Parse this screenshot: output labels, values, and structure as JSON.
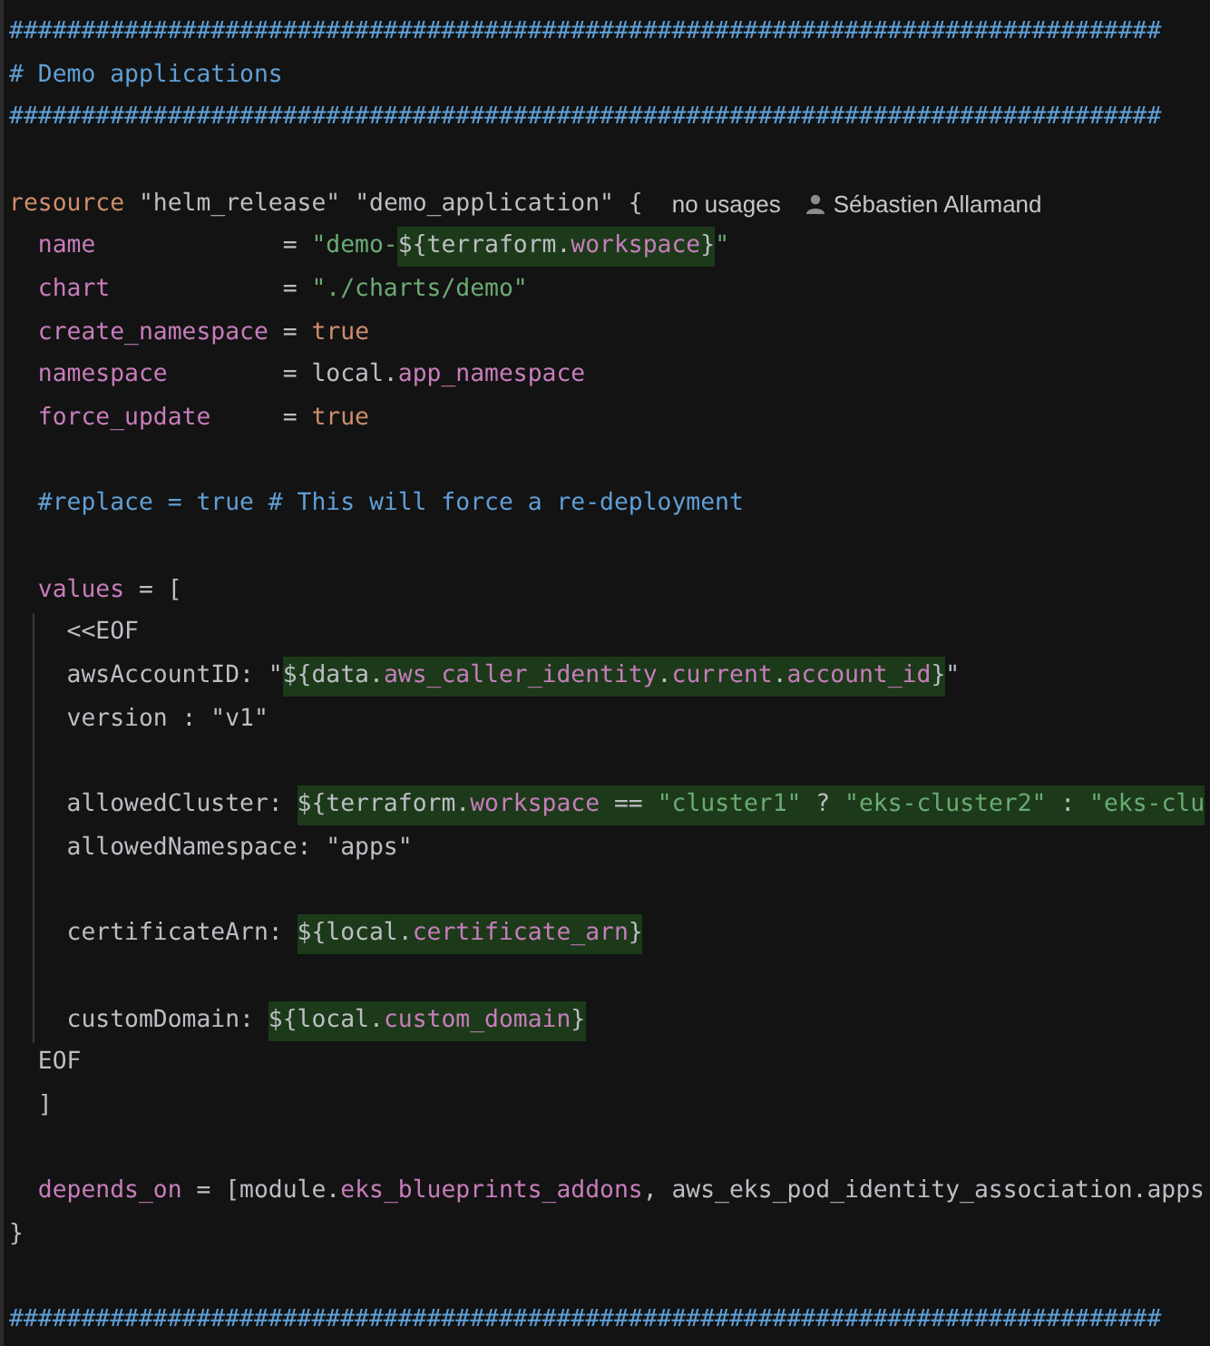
{
  "editor": {
    "lines": [
      {
        "kind": "code",
        "guide": false,
        "tokens": [
          {
            "kind": "comment",
            "text": "################################################################################"
          }
        ]
      },
      {
        "kind": "code",
        "guide": false,
        "tokens": [
          {
            "kind": "comment",
            "text": "# Demo applications"
          }
        ]
      },
      {
        "kind": "code",
        "guide": false,
        "tokens": [
          {
            "kind": "comment",
            "text": "################################################################################"
          }
        ]
      },
      {
        "kind": "blank",
        "guide": false
      },
      {
        "kind": "code",
        "guide": false,
        "tokens": [
          {
            "kind": "keyword",
            "text": "resource"
          },
          {
            "kind": "plain",
            "text": " \"helm_release\" \"demo_application\" {"
          }
        ],
        "hints": [
          {
            "kind": "usages",
            "text": "no usages"
          },
          {
            "kind": "author",
            "text": "Sébastien Allamand"
          }
        ]
      },
      {
        "kind": "code",
        "guide": false,
        "tokens": [
          {
            "kind": "property",
            "text": "  name"
          },
          {
            "kind": "plain",
            "text": "             = "
          },
          {
            "kind": "string",
            "text": "\"demo-"
          },
          {
            "kind": "interpolation",
            "tokens": [
              {
                "kind": "plain",
                "text": "${terraform."
              },
              {
                "kind": "member",
                "text": "workspace"
              },
              {
                "kind": "plain",
                "text": "}"
              }
            ]
          },
          {
            "kind": "string",
            "text": "\""
          }
        ]
      },
      {
        "kind": "code",
        "guide": false,
        "tokens": [
          {
            "kind": "property",
            "text": "  chart"
          },
          {
            "kind": "plain",
            "text": "            = "
          },
          {
            "kind": "string",
            "text": "\"./charts/demo\""
          }
        ]
      },
      {
        "kind": "code",
        "guide": false,
        "tokens": [
          {
            "kind": "property",
            "text": "  create_namespace"
          },
          {
            "kind": "plain",
            "text": " = "
          },
          {
            "kind": "bool",
            "text": "true"
          }
        ]
      },
      {
        "kind": "code",
        "guide": false,
        "tokens": [
          {
            "kind": "property",
            "text": "  namespace"
          },
          {
            "kind": "plain",
            "text": "        = local."
          },
          {
            "kind": "member",
            "text": "app_namespace"
          }
        ]
      },
      {
        "kind": "code",
        "guide": false,
        "tokens": [
          {
            "kind": "property",
            "text": "  force_update"
          },
          {
            "kind": "plain",
            "text": "     = "
          },
          {
            "kind": "bool",
            "text": "true"
          }
        ]
      },
      {
        "kind": "blank",
        "guide": false
      },
      {
        "kind": "code",
        "guide": false,
        "tokens": [
          {
            "kind": "comment",
            "text": "  #replace = true # This will force a re-deployment"
          }
        ]
      },
      {
        "kind": "blank",
        "guide": false
      },
      {
        "kind": "code",
        "guide": false,
        "tokens": [
          {
            "kind": "property",
            "text": "  values"
          },
          {
            "kind": "plain",
            "text": " = ["
          }
        ]
      },
      {
        "kind": "code",
        "guide": true,
        "tokens": [
          {
            "kind": "plain",
            "text": "    <<EOF"
          }
        ]
      },
      {
        "kind": "code",
        "guide": true,
        "tokens": [
          {
            "kind": "plain",
            "text": "    awsAccountID: \""
          },
          {
            "kind": "interpolation",
            "tokens": [
              {
                "kind": "plain",
                "text": "${data."
              },
              {
                "kind": "member",
                "text": "aws_caller_identity"
              },
              {
                "kind": "plain",
                "text": "."
              },
              {
                "kind": "member",
                "text": "current"
              },
              {
                "kind": "plain",
                "text": "."
              },
              {
                "kind": "member",
                "text": "account_id"
              },
              {
                "kind": "plain",
                "text": "}"
              }
            ]
          },
          {
            "kind": "plain",
            "text": "\""
          }
        ]
      },
      {
        "kind": "code",
        "guide": true,
        "tokens": [
          {
            "kind": "plain",
            "text": "    version : \"v1\""
          }
        ]
      },
      {
        "kind": "blank",
        "guide": true
      },
      {
        "kind": "code",
        "guide": true,
        "tokens": [
          {
            "kind": "plain",
            "text": "    allowedCluster: "
          },
          {
            "kind": "interpolation",
            "tokens": [
              {
                "kind": "plain",
                "text": "${terraform."
              },
              {
                "kind": "member",
                "text": "workspace"
              },
              {
                "kind": "plain",
                "text": " == "
              },
              {
                "kind": "string",
                "text": "\"cluster1\""
              },
              {
                "kind": "plain",
                "text": " ? "
              },
              {
                "kind": "string",
                "text": "\"eks-cluster2\""
              },
              {
                "kind": "plain",
                "text": " : "
              },
              {
                "kind": "string",
                "text": "\"eks-clu"
              }
            ]
          }
        ]
      },
      {
        "kind": "code",
        "guide": true,
        "tokens": [
          {
            "kind": "plain",
            "text": "    allowedNamespace: \"apps\""
          }
        ]
      },
      {
        "kind": "blank",
        "guide": true
      },
      {
        "kind": "code",
        "guide": true,
        "tokens": [
          {
            "kind": "plain",
            "text": "    certificateArn: "
          },
          {
            "kind": "interpolation",
            "tokens": [
              {
                "kind": "plain",
                "text": "${local."
              },
              {
                "kind": "member",
                "text": "certificate_arn"
              },
              {
                "kind": "plain",
                "text": "}"
              }
            ]
          }
        ]
      },
      {
        "kind": "blank",
        "guide": true
      },
      {
        "kind": "code",
        "guide": true,
        "tokens": [
          {
            "kind": "plain",
            "text": "    customDomain: "
          },
          {
            "kind": "interpolation",
            "tokens": [
              {
                "kind": "plain",
                "text": "${local."
              },
              {
                "kind": "member",
                "text": "custom_domain"
              },
              {
                "kind": "plain",
                "text": "}"
              }
            ]
          }
        ]
      },
      {
        "kind": "code",
        "guide": false,
        "tokens": [
          {
            "kind": "plain",
            "text": "  EOF"
          }
        ]
      },
      {
        "kind": "code",
        "guide": false,
        "tokens": [
          {
            "kind": "plain",
            "text": "  ]"
          }
        ]
      },
      {
        "kind": "blank",
        "guide": false
      },
      {
        "kind": "code",
        "guide": false,
        "tokens": [
          {
            "kind": "property",
            "text": "  depends_on"
          },
          {
            "kind": "plain",
            "text": " = [module."
          },
          {
            "kind": "member",
            "text": "eks_blueprints_addons"
          },
          {
            "kind": "plain",
            "text": ", aws_eks_pod_identity_association.apps"
          }
        ]
      },
      {
        "kind": "code",
        "guide": false,
        "tokens": [
          {
            "kind": "plain",
            "text": "}"
          }
        ]
      },
      {
        "kind": "blank",
        "guide": false
      },
      {
        "kind": "code",
        "guide": false,
        "tokens": [
          {
            "kind": "comment",
            "text": "################################################################################"
          }
        ]
      }
    ]
  }
}
